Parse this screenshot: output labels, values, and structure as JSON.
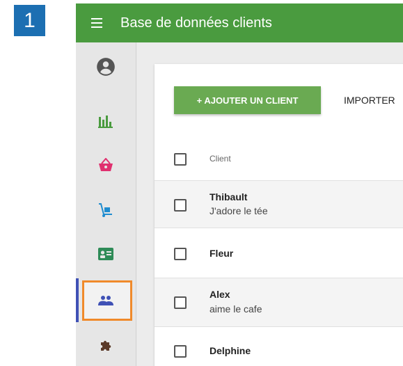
{
  "step": {
    "number": "1",
    "color": "#1c6fb2"
  },
  "app": {
    "title": "Base de données clients",
    "appbar_color": "#4a9b3f"
  },
  "sidebar": {
    "items": [
      {
        "icon": "account-circle-icon",
        "color": "#555555"
      },
      {
        "icon": "bar-chart-icon",
        "color": "#4a9b3f"
      },
      {
        "icon": "shopping-basket-icon",
        "color": "#e0306f"
      },
      {
        "icon": "hand-truck-icon",
        "color": "#1f8ccf"
      },
      {
        "icon": "contact-card-icon",
        "color": "#2e8b57"
      },
      {
        "icon": "people-icon",
        "color": "#3f51b5",
        "selected": true
      },
      {
        "icon": "puzzle-icon",
        "color": "#5b3a29"
      }
    ],
    "highlight_color": "#f08a2b"
  },
  "toolbar": {
    "add_label": "+ AJOUTER UN CLIENT",
    "import_label": "IMPORTER"
  },
  "table": {
    "header": "Client",
    "rows": [
      {
        "name": "Thibault",
        "note": "J'adore le tée"
      },
      {
        "name": "Fleur",
        "note": ""
      },
      {
        "name": "Alex",
        "note": "aime le cafe"
      },
      {
        "name": "Delphine",
        "note": ""
      }
    ]
  }
}
